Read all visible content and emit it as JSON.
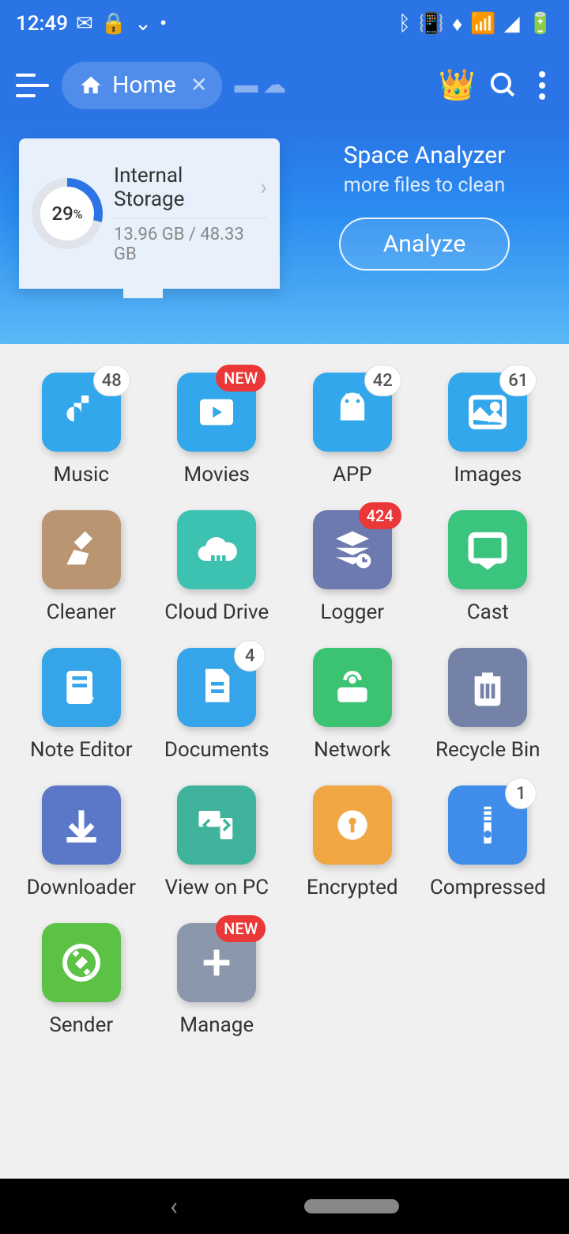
{
  "status": {
    "time": "12:49",
    "left_icons": [
      "✉",
      "🔒",
      "⌄",
      "•"
    ],
    "right_icons": [
      "ᛒ",
      "📳",
      "♦",
      "📶₅",
      "◢",
      "🔋"
    ]
  },
  "header": {
    "tab_label": "Home"
  },
  "storage": {
    "percent": "29",
    "percent_unit": "%",
    "title": "Internal Storage",
    "used": "13.96 GB",
    "total": "48.33 GB"
  },
  "analyzer": {
    "title": "Space Analyzer",
    "subtitle": "more files to clean",
    "button": "Analyze"
  },
  "categories": [
    {
      "label": "Music",
      "badge": "48",
      "badge_type": "white",
      "color": "#33a7ec",
      "icon": "music"
    },
    {
      "label": "Movies",
      "badge": "NEW",
      "badge_type": "red",
      "color": "#33a7ec",
      "icon": "movie"
    },
    {
      "label": "APP",
      "badge": "42",
      "badge_type": "white",
      "color": "#33a7ec",
      "icon": "android"
    },
    {
      "label": "Images",
      "badge": "61",
      "badge_type": "white",
      "color": "#33a7ec",
      "icon": "image"
    },
    {
      "label": "Cleaner",
      "badge": null,
      "color": "#b99571",
      "icon": "broom"
    },
    {
      "label": "Cloud Drive",
      "badge": null,
      "color": "#3dc1b0",
      "icon": "cloud"
    },
    {
      "label": "Logger",
      "badge": "424",
      "badge_type": "red",
      "color": "#6d7ab0",
      "icon": "stack"
    },
    {
      "label": "Cast",
      "badge": null,
      "color": "#3bc47e",
      "icon": "cast"
    },
    {
      "label": "Note Editor",
      "badge": null,
      "color": "#35a4e8",
      "icon": "note"
    },
    {
      "label": "Documents",
      "badge": "4",
      "badge_type": "white",
      "color": "#35a4e8",
      "icon": "doc"
    },
    {
      "label": "Network",
      "badge": null,
      "color": "#3cc372",
      "icon": "router"
    },
    {
      "label": "Recycle Bin",
      "badge": null,
      "color": "#7482a7",
      "icon": "trash"
    },
    {
      "label": "Downloader",
      "badge": null,
      "color": "#5a78c7",
      "icon": "download"
    },
    {
      "label": "View on PC",
      "badge": null,
      "color": "#3fb39b",
      "icon": "pc"
    },
    {
      "label": "Encrypted",
      "badge": null,
      "color": "#f0a642",
      "icon": "lock"
    },
    {
      "label": "Compressed",
      "badge": "1",
      "badge_type": "white",
      "color": "#3f8de8",
      "icon": "zip"
    },
    {
      "label": "Sender",
      "badge": null,
      "color": "#5bc246",
      "icon": "sender"
    },
    {
      "label": "Manage",
      "badge": "NEW",
      "badge_type": "red",
      "color": "#8b97aa",
      "icon": "plus"
    }
  ]
}
